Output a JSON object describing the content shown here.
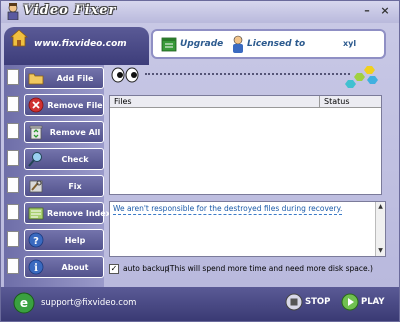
{
  "window": {
    "title": "Video Fixer",
    "minimize": "–",
    "close": "×"
  },
  "header": {
    "site_url": "www.fixvideo.com",
    "upgrade_label": "Upgrade",
    "licensed_label": "Licensed to",
    "licensed_user": "xyl"
  },
  "sidebar": {
    "items": [
      {
        "label": "Add File",
        "icon": "folder-open-icon"
      },
      {
        "label": "Remove File",
        "icon": "remove-icon"
      },
      {
        "label": "Remove All",
        "icon": "recycle-bin-icon"
      },
      {
        "label": "Check",
        "icon": "check-magnifier-icon"
      },
      {
        "label": "Fix",
        "icon": "fix-tools-icon"
      },
      {
        "label": "Remove Index",
        "icon": "remove-index-icon"
      },
      {
        "label": "Help",
        "icon": "help-icon"
      },
      {
        "label": "About",
        "icon": "info-icon"
      }
    ]
  },
  "file_table": {
    "columns": [
      "Files",
      "Status"
    ],
    "rows": []
  },
  "log": {
    "message": "We aren't responsible for the destroyed files during recovery."
  },
  "backup": {
    "checked": true,
    "check_glyph": "✓",
    "label": "auto backup",
    "note": "(This will spend more time and need more disk space.)"
  },
  "footer": {
    "support_email": "support@fixvideo.com",
    "stop_label": "STOP",
    "play_label": "PLAY"
  },
  "colors": {
    "accent": "#4a4a8a",
    "link_blue": "#2c5a8e",
    "log_text": "#1a5aa8"
  }
}
